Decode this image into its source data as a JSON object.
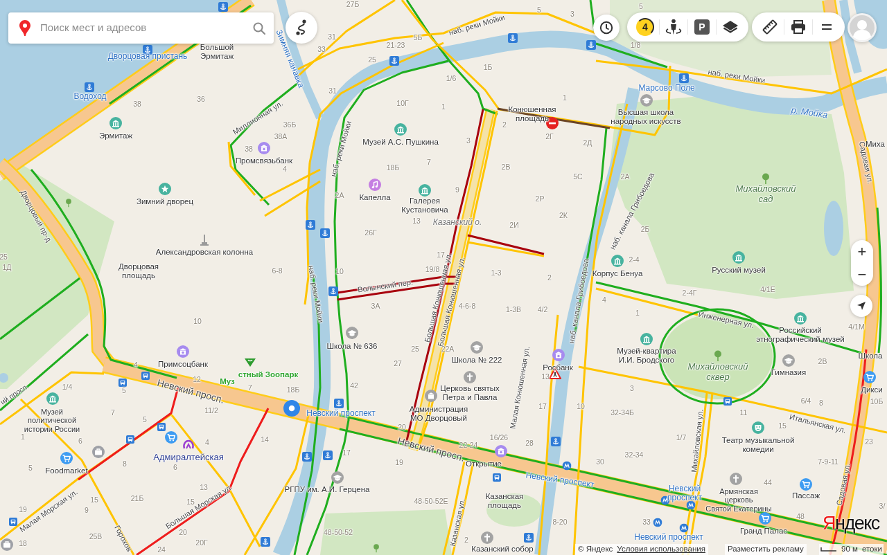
{
  "search": {
    "placeholder": "Поиск мест и адресов"
  },
  "controls": {
    "traffic_score": "4",
    "parking": "P",
    "zoom_in": "+",
    "zoom_out": "−"
  },
  "labels": [
    {
      "kind": "pier",
      "text": "Дворцовая пристань"
    },
    {
      "kind": "pier",
      "text": "Водоход"
    },
    {
      "kind": "poi",
      "text": "Большой\nЭрмитаж"
    },
    {
      "kind": "canal",
      "text": "Зимняя канавка"
    },
    {
      "kind": "house",
      "text": "38"
    },
    {
      "kind": "house",
      "text": "36"
    },
    {
      "kind": "poi",
      "text": "Эрмитаж"
    },
    {
      "kind": "street",
      "text": "Миллионная ул."
    },
    {
      "kind": "house",
      "text": "36Б"
    },
    {
      "kind": "house",
      "text": "38А"
    },
    {
      "kind": "house",
      "text": "38"
    },
    {
      "kind": "poi",
      "text": "Промсвязьбанк"
    },
    {
      "kind": "house",
      "text": "4"
    },
    {
      "kind": "street",
      "text": "Дворцовый пр-д"
    },
    {
      "kind": "poi",
      "text": "Зимний дворец"
    },
    {
      "kind": "poi",
      "text": "Александровская колонна"
    },
    {
      "kind": "poi",
      "text": "Дворцовая\nплощадь"
    },
    {
      "kind": "house",
      "text": "25"
    },
    {
      "kind": "house",
      "text": "1Д"
    },
    {
      "kind": "house",
      "text": "6-8"
    },
    {
      "kind": "house",
      "text": "27Б"
    },
    {
      "kind": "house",
      "text": "31"
    },
    {
      "kind": "house",
      "text": "33"
    },
    {
      "kind": "house",
      "text": "21-23"
    },
    {
      "kind": "house",
      "text": "5Б"
    },
    {
      "kind": "street",
      "text": "наб. реки Мойки"
    },
    {
      "kind": "house",
      "text": "5"
    },
    {
      "kind": "house",
      "text": "3"
    },
    {
      "kind": "house",
      "text": "25"
    },
    {
      "kind": "house",
      "text": "1Б"
    },
    {
      "kind": "house",
      "text": "31"
    },
    {
      "kind": "house",
      "text": "1/6"
    },
    {
      "kind": "house",
      "text": "1"
    },
    {
      "kind": "house",
      "text": "10Г"
    },
    {
      "kind": "house",
      "text": "1"
    },
    {
      "kind": "poi",
      "text": "Конюшенная\nплощадь"
    },
    {
      "kind": "street",
      "text": "наб. реки Мойки"
    },
    {
      "kind": "poi",
      "text": "Музей А.С. Пушкина"
    },
    {
      "kind": "house",
      "text": "2"
    },
    {
      "kind": "house",
      "text": "3"
    },
    {
      "kind": "house",
      "text": "2Г"
    },
    {
      "kind": "house",
      "text": "2Д"
    },
    {
      "kind": "house",
      "text": "18Б"
    },
    {
      "kind": "house",
      "text": "7"
    },
    {
      "kind": "house",
      "text": "2В"
    },
    {
      "kind": "house",
      "text": "5С"
    },
    {
      "kind": "house",
      "text": "2А"
    },
    {
      "kind": "poi",
      "text": "Капелла"
    },
    {
      "kind": "poi",
      "text": "Галерея\nКустановича"
    },
    {
      "kind": "house",
      "text": "9"
    },
    {
      "kind": "house",
      "text": "2Р"
    },
    {
      "kind": "house",
      "text": "13"
    },
    {
      "kind": "island",
      "text": "Казанский о."
    },
    {
      "kind": "house",
      "text": "2И"
    },
    {
      "kind": "house",
      "text": "2К"
    },
    {
      "kind": "house",
      "text": "26Г"
    },
    {
      "kind": "house",
      "text": "17"
    },
    {
      "kind": "house",
      "text": "10"
    },
    {
      "kind": "house",
      "text": "19/8"
    },
    {
      "kind": "house",
      "text": "1-3"
    },
    {
      "kind": "house",
      "text": "5"
    },
    {
      "kind": "house",
      "text": "1/8"
    },
    {
      "kind": "street",
      "text": "наб. реки Мойки"
    },
    {
      "kind": "pier",
      "text": "Марсово Поле"
    },
    {
      "kind": "poi",
      "text": "Высшая школа\nнародных искусств"
    },
    {
      "kind": "river",
      "text": "р. Мойка"
    },
    {
      "kind": "street",
      "text": "Садовая ул."
    },
    {
      "kind": "poi",
      "text": "Миха"
    },
    {
      "kind": "park",
      "text": "Михайловский\nсад"
    },
    {
      "kind": "house",
      "text": "2А"
    },
    {
      "kind": "street",
      "text": "наб. канала Грибоедова"
    },
    {
      "kind": "house",
      "text": "2Б"
    },
    {
      "kind": "house",
      "text": "2-4"
    },
    {
      "kind": "street",
      "text": "наб. реки Мойки"
    },
    {
      "kind": "poi",
      "text": "Корпус Бенуа"
    },
    {
      "kind": "poi",
      "text": "Русский музей"
    },
    {
      "kind": "street",
      "text": "Волынский пер."
    },
    {
      "kind": "street",
      "text": "Большая Конюшенная ул."
    },
    {
      "kind": "street",
      "text": "Большая Конюшенная ул."
    },
    {
      "kind": "house",
      "text": "2"
    },
    {
      "kind": "house",
      "text": "3А"
    },
    {
      "kind": "house",
      "text": "4-6-8"
    },
    {
      "kind": "house",
      "text": "1-3В"
    },
    {
      "kind": "house",
      "text": "4/2"
    },
    {
      "kind": "street",
      "text": "наб. канала Грибоедова"
    },
    {
      "kind": "poi",
      "text": "Школа № 636"
    },
    {
      "kind": "house",
      "text": "25"
    },
    {
      "kind": "house",
      "text": "22А"
    },
    {
      "kind": "house",
      "text": "27"
    },
    {
      "kind": "poi",
      "text": "Школа № 222"
    },
    {
      "kind": "street",
      "text": "Малая Конюшенная ул."
    },
    {
      "kind": "poi",
      "text": "Росбанк"
    },
    {
      "kind": "house",
      "text": "13"
    },
    {
      "kind": "house",
      "text": "42"
    },
    {
      "kind": "poi",
      "text": "Церковь святых\nПетра и Павла"
    },
    {
      "kind": "stop",
      "text": "Невский проспект"
    },
    {
      "kind": "poi",
      "text": "Администрация\nМО Дворцовый"
    },
    {
      "kind": "house",
      "text": "17"
    },
    {
      "kind": "house",
      "text": "10"
    },
    {
      "kind": "house",
      "text": "20"
    },
    {
      "kind": "street",
      "text": "Невский просп."
    },
    {
      "kind": "house",
      "text": "22-24"
    },
    {
      "kind": "house",
      "text": "16/26"
    },
    {
      "kind": "house",
      "text": "28"
    },
    {
      "kind": "poi",
      "text": "Открытие"
    },
    {
      "kind": "house",
      "text": "17"
    },
    {
      "kind": "house",
      "text": "19"
    },
    {
      "kind": "poi",
      "text": "РГПУ им. А.И. Герцена"
    },
    {
      "kind": "stop",
      "text": "Невский проспект"
    },
    {
      "kind": "house",
      "text": "48-50-52Е"
    },
    {
      "kind": "poi",
      "text": "Казанская\nплощадь"
    },
    {
      "kind": "house",
      "text": "48-50-52"
    },
    {
      "kind": "street",
      "text": "Казанская ул."
    },
    {
      "kind": "house",
      "text": "8-20"
    },
    {
      "kind": "house",
      "text": "2"
    },
    {
      "kind": "poi",
      "text": "Казанский собор"
    },
    {
      "kind": "house",
      "text": "2-4Г"
    },
    {
      "kind": "house",
      "text": "4/1Е"
    },
    {
      "kind": "house",
      "text": "4"
    },
    {
      "kind": "house",
      "text": "1"
    },
    {
      "kind": "street",
      "text": "Инженерная ул."
    },
    {
      "kind": "poi",
      "text": "Российский\nэтнографический музей"
    },
    {
      "kind": "house",
      "text": "4/1М"
    },
    {
      "kind": "poi",
      "text": "Музей-квартира\nИ.И. Бродского"
    },
    {
      "kind": "park",
      "text": "Михайловский\nсквер"
    },
    {
      "kind": "poi",
      "text": "Гимназия"
    },
    {
      "kind": "house",
      "text": "2В"
    },
    {
      "kind": "poi",
      "text": "Школа"
    },
    {
      "kind": "house",
      "text": "3"
    },
    {
      "kind": "poi",
      "text": "Дикси"
    },
    {
      "kind": "house",
      "text": "32-34Б"
    },
    {
      "kind": "street",
      "text": "Михайловская ул."
    },
    {
      "kind": "house",
      "text": "6/4"
    },
    {
      "kind": "house",
      "text": "8"
    },
    {
      "kind": "house",
      "text": "10Б"
    },
    {
      "kind": "house",
      "text": "1/7"
    },
    {
      "kind": "house",
      "text": "11"
    },
    {
      "kind": "house",
      "text": "15"
    },
    {
      "kind": "street",
      "text": "Итальянская ул."
    },
    {
      "kind": "poi",
      "text": "Театр музыкальной\nкомедии"
    },
    {
      "kind": "house",
      "text": "23"
    },
    {
      "kind": "house",
      "text": "30"
    },
    {
      "kind": "house",
      "text": "32-34"
    },
    {
      "kind": "house",
      "text": "7-9-11"
    },
    {
      "kind": "stop",
      "text": "Невский\nпроспект"
    },
    {
      "kind": "house",
      "text": "44"
    },
    {
      "kind": "poi",
      "text": "Армянская\nцерковь\nСвятой Екатерины"
    },
    {
      "kind": "poi",
      "text": "Пассаж"
    },
    {
      "kind": "house",
      "text": "33"
    },
    {
      "kind": "house",
      "text": "48"
    },
    {
      "kind": "stop",
      "text": "Невский проспект"
    },
    {
      "kind": "poi",
      "text": "Гранд Палас"
    },
    {
      "kind": "street",
      "text": "Садовая ул."
    },
    {
      "kind": "house",
      "text": "3/"
    },
    {
      "kind": "house",
      "text": "10"
    },
    {
      "kind": "house",
      "text": "4"
    },
    {
      "kind": "poi",
      "text": "Примсоцбанк"
    },
    {
      "kind": "house",
      "text": "12"
    },
    {
      "kind": "green",
      "text": "Муз"
    },
    {
      "kind": "green",
      "text": "стный Зоопарк"
    },
    {
      "kind": "street",
      "text": "ий просп."
    },
    {
      "kind": "house",
      "text": "1/4"
    },
    {
      "kind": "house",
      "text": "5"
    },
    {
      "kind": "street",
      "text": "Невский просп."
    },
    {
      "kind": "house",
      "text": "7"
    },
    {
      "kind": "house",
      "text": "18Б"
    },
    {
      "kind": "poi",
      "text": "Музей\nполитической\nистории России"
    },
    {
      "kind": "house",
      "text": "7"
    },
    {
      "kind": "house",
      "text": "5"
    },
    {
      "kind": "house",
      "text": "11/2"
    },
    {
      "kind": "house",
      "text": "1"
    },
    {
      "kind": "house",
      "text": "6"
    },
    {
      "kind": "house",
      "text": "4"
    },
    {
      "kind": "house",
      "text": "14"
    },
    {
      "kind": "station",
      "text": "Адмиралтейская"
    },
    {
      "kind": "house",
      "text": "5"
    },
    {
      "kind": "poi",
      "text": "Foodmarket"
    },
    {
      "kind": "house",
      "text": "8"
    },
    {
      "kind": "house",
      "text": "6"
    },
    {
      "kind": "street",
      "text": "Малая Морская ул."
    },
    {
      "kind": "house",
      "text": "15"
    },
    {
      "kind": "house",
      "text": "21Б"
    },
    {
      "kind": "house",
      "text": "15"
    },
    {
      "kind": "street",
      "text": "Большая Морская ул."
    },
    {
      "kind": "house",
      "text": "13"
    },
    {
      "kind": "house",
      "text": "19"
    },
    {
      "kind": "house",
      "text": "9"
    },
    {
      "kind": "house",
      "text": "18"
    },
    {
      "kind": "house",
      "text": "25В"
    },
    {
      "kind": "street",
      "text": "Горохов"
    },
    {
      "kind": "house",
      "text": "20"
    },
    {
      "kind": "house",
      "text": "24"
    },
    {
      "kind": "house",
      "text": "20Г"
    }
  ],
  "logo": "Яндекс",
  "scale": "90 м",
  "footer": {
    "copyright": "© Яндекс",
    "terms": "Условия использования",
    "ads": "Разместить рекламу",
    "partial": "етоки"
  }
}
